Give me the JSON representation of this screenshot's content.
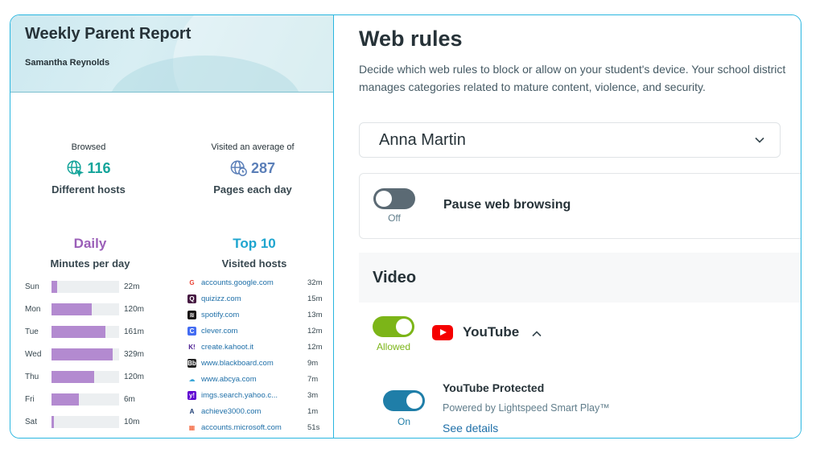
{
  "report": {
    "title": "Weekly Parent Report",
    "student": "Samantha Reynolds",
    "browsed": {
      "caption": "Browsed",
      "value": "116",
      "label": "Different hosts",
      "icon": "globe-cursor-icon",
      "color": "#14a49a"
    },
    "visited": {
      "caption": "Visited an average of",
      "value": "287",
      "label": "Pages each day",
      "icon": "globe-clock-icon",
      "color": "#5b7fb8"
    },
    "daily": {
      "title": "Daily",
      "subtitle": "Minutes per day",
      "color": "#9b5fb8",
      "days": [
        {
          "label": "Sun",
          "value": "22m",
          "fraction": 0.08
        },
        {
          "label": "Mon",
          "value": "120m",
          "fraction": 0.6
        },
        {
          "label": "Tue",
          "value": "161m",
          "fraction": 0.8
        },
        {
          "label": "Wed",
          "value": "329m",
          "fraction": 0.9
        },
        {
          "label": "Thu",
          "value": "120m",
          "fraction": 0.63
        },
        {
          "label": "Fri",
          "value": "6m",
          "fraction": 0.4
        },
        {
          "label": "Sat",
          "value": "10m",
          "fraction": 0.04
        }
      ]
    },
    "top": {
      "title": "Top 10",
      "subtitle": "Visited hosts",
      "color": "#1ea5cf",
      "hosts": [
        {
          "name": "accounts.google.com",
          "value": "32m",
          "icon": "google-icon",
          "glyph": "G",
          "color": "#ffffff",
          "text": "#ea4335"
        },
        {
          "name": "quizizz.com",
          "value": "15m",
          "icon": "quizizz-icon",
          "glyph": "Q",
          "color": "#461a42",
          "text": "#ffffff"
        },
        {
          "name": "spotify.com",
          "value": "13m",
          "icon": "spotify-icon",
          "glyph": "≋",
          "color": "#191414",
          "text": "#ffffff"
        },
        {
          "name": "clever.com",
          "value": "12m",
          "icon": "clever-icon",
          "glyph": "C",
          "color": "#436cf2",
          "text": "#ffffff"
        },
        {
          "name": "create.kahoot.it",
          "value": "12m",
          "icon": "kahoot-icon",
          "glyph": "K!",
          "color": "#ffffff",
          "text": "#46178f"
        },
        {
          "name": "www.blackboard.com",
          "value": "9m",
          "icon": "blackboard-icon",
          "glyph": "Bb",
          "color": "#222222",
          "text": "#ffffff"
        },
        {
          "name": "www.abcya.com",
          "value": "7m",
          "icon": "abcya-icon",
          "glyph": "☁",
          "color": "#ffffff",
          "text": "#3aa7d8"
        },
        {
          "name": "imgs.search.yahoo.c...",
          "value": "3m",
          "icon": "yahoo-icon",
          "glyph": "y!",
          "color": "#6001d2",
          "text": "#ffffff"
        },
        {
          "name": "achieve3000.com",
          "value": "1m",
          "icon": "achieve3000-icon",
          "glyph": "A",
          "color": "#ffffff",
          "text": "#1b3c73"
        },
        {
          "name": "accounts.microsoft.com",
          "value": "51s",
          "icon": "microsoft-icon",
          "glyph": "▦",
          "color": "#ffffff",
          "text": "#f25022"
        }
      ]
    }
  },
  "web_rules": {
    "title": "Web rules",
    "description": "Decide which web rules to block or allow on your student's device. Your school district manages categories related to mature content, violence, and security.",
    "student_select": "Anna Martin",
    "pause": {
      "label": "Pause web browsing",
      "state": "Off",
      "on": false
    },
    "video": {
      "heading": "Video",
      "youtube": {
        "name": "YouTube",
        "state": "Allowed",
        "on": true,
        "color": "#7cb518"
      },
      "protected": {
        "title": "YouTube Protected",
        "subtitle": "Powered by Lightspeed Smart Play™",
        "link": "See details",
        "state": "On",
        "on": true,
        "color": "#1f7ea8"
      }
    }
  }
}
